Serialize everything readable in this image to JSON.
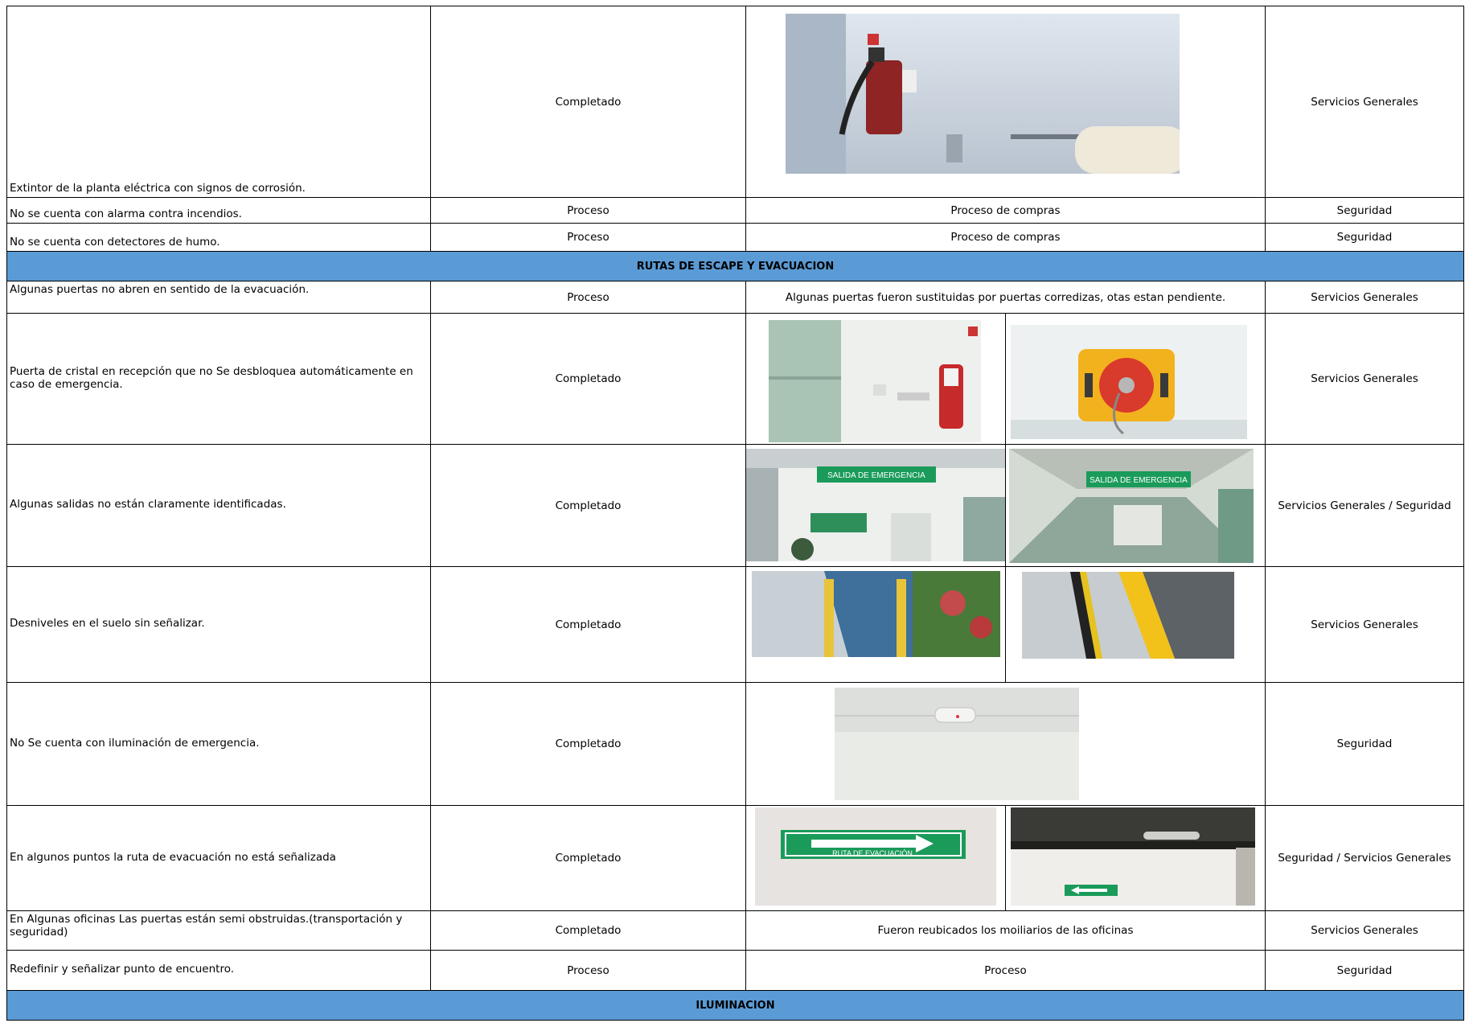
{
  "rows": [
    {
      "desc": "Extintor de la planta eléctrica con signos de corrosión.",
      "status": "Completado",
      "evidence": "",
      "responsible": "Servicios Generales"
    },
    {
      "desc": "No se cuenta con alarma contra incendios.",
      "status": "Proceso",
      "evidence": "Proceso de compras",
      "responsible": "Seguridad"
    },
    {
      "desc": "No se cuenta con detectores de humo.",
      "status": "Proceso",
      "evidence": "Proceso de compras",
      "responsible": "Seguridad"
    },
    {
      "desc": "Algunas puertas no abren en sentido de la evacuación.",
      "status": "Proceso",
      "evidence": "Algunas puertas fueron sustituidas por puertas corredizas, otas estan pendiente.",
      "responsible": "Servicios Generales"
    },
    {
      "desc": " Puerta de cristal en recepción que no Se desbloquea automáticamente en caso de emergencia.",
      "status": "Completado",
      "evidence": "",
      "responsible": "Servicios Generales"
    },
    {
      "desc": "Algunas salidas no están claramente identificadas.",
      "status": "Completado",
      "evidence": "",
      "responsible": "Servicios Generales / Seguridad"
    },
    {
      "desc": "Desniveles en el suelo sin señalizar.",
      "status": "Completado",
      "evidence": "",
      "responsible": "Servicios Generales"
    },
    {
      "desc": "No Se cuenta con iluminación de emergencia.",
      "status": "Completado",
      "evidence": "",
      "responsible": "Seguridad"
    },
    {
      "desc": "En algunos puntos la ruta de evacuación no está señalizada",
      "status": "Completado",
      "evidence": "",
      "responsible": "Seguridad / Servicios Generales"
    },
    {
      "desc": "En Algunas oficinas Las puertas están semi obstruidas.(transportación y seguridad)",
      "status": "Completado",
      "evidence": "Fueron reubicados los moiliarios de las oficinas",
      "responsible": "Servicios Generales"
    },
    {
      "desc": " Redefinir y señalizar punto de encuentro.",
      "status": "Proceso",
      "evidence": "Proceso",
      "responsible": "Seguridad"
    }
  ],
  "sections": {
    "escape": "RUTAS DE ESCAPE Y EVACUACION",
    "lighting": "ILUMINACION"
  },
  "photos": {
    "exit_sign_1": "SALIDA DE EMERGENCIA",
    "exit_sign_2": "SALIDA DE EMERGENCIA",
    "route_sign": "RUTA DE EVACUACIÓN"
  },
  "colors": {
    "section_header": "#5b9bd5",
    "sign_green": "#1a9b5a"
  }
}
